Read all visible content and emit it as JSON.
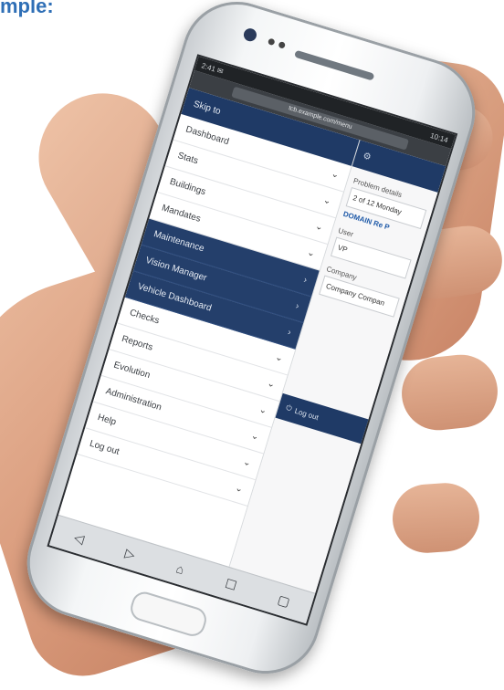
{
  "caption": "mple:",
  "statusbar": {
    "left": "2:41 ✉",
    "right": "10:14"
  },
  "browser": {
    "url": "tcb.example.com/menu"
  },
  "menu": {
    "header": "Skip to",
    "items": [
      {
        "label": "Dashboard",
        "dark": false
      },
      {
        "label": "Stats",
        "dark": false
      },
      {
        "label": "Buildings",
        "dark": false
      },
      {
        "label": "Mandates",
        "dark": false
      },
      {
        "label": "Maintenance",
        "dark": true
      },
      {
        "label": "Vision Manager",
        "dark": true
      },
      {
        "label": "Vehicle Dashboard",
        "dark": true
      },
      {
        "label": "Checks",
        "dark": false
      },
      {
        "label": "Reports",
        "dark": false
      },
      {
        "label": "Evolution",
        "dark": false
      },
      {
        "label": "Administration",
        "dark": false
      },
      {
        "label": "Help",
        "dark": false
      },
      {
        "label": "Log out",
        "dark": false
      }
    ]
  },
  "panel": {
    "title_label": "Problem details",
    "date_text": "2 of 12 Monday",
    "link_text": "DOMAIN Re P",
    "user_label": "User",
    "user_value": "VP",
    "company_label": "Company",
    "company_value": "Company Compan",
    "logout_label": "Log out"
  },
  "colors": {
    "accent": "#1f3a66",
    "link": "#1f5aa8",
    "caption": "#2f6fb6"
  }
}
